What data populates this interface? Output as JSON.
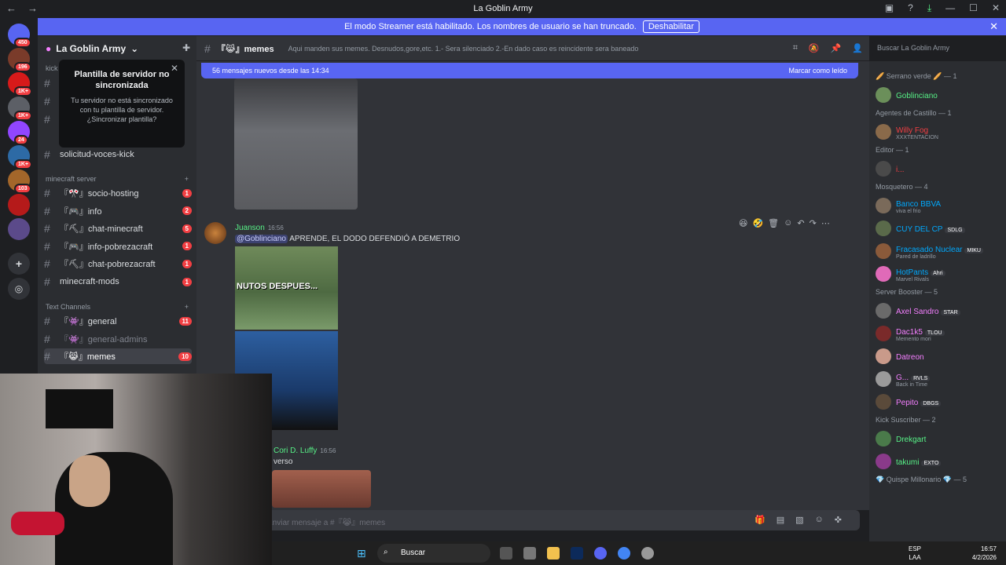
{
  "window": {
    "title": "La Goblin Army"
  },
  "banner": {
    "text": "El modo Streamer está habilitado. Los nombres de usuario se han truncado.",
    "button": "Deshabilitar"
  },
  "guilds": [
    {
      "badge": "450",
      "color": "#5865f2"
    },
    {
      "badge": "196",
      "color": "#7a3b2a"
    },
    {
      "badge": "1K+",
      "color": "#d71a1a"
    },
    {
      "badge": "1K+",
      "color": "#5c5f66"
    },
    {
      "badge": "24",
      "color": "#9146ff"
    },
    {
      "badge": "1K+",
      "color": "#2d6aa5"
    },
    {
      "badge": "103",
      "color": "#a3662a"
    },
    {
      "badge": "",
      "color": "#b51a1a"
    },
    {
      "badge": "",
      "color": "#5b4a8a"
    }
  ],
  "server": {
    "name": "La Goblin Army"
  },
  "popup": {
    "title": "Plantilla de servidor no sincronizada",
    "body": "Tu servidor no está sincronizado con tu plantilla de servidor. ¿Sincronizar plantilla?"
  },
  "channels": {
    "top_category": "kick",
    "solicitud": "solicitud-voces-kick",
    "minecraft_category": "minecraft server",
    "minecraft": [
      {
        "label": "『🎌』socio-hosting",
        "badge": "1"
      },
      {
        "label": "『🎮』info",
        "badge": "2"
      },
      {
        "label": "『⛏』chat-minecraft",
        "badge": "5"
      },
      {
        "label": "『🎮』info-pobrezacraft",
        "badge": "1"
      },
      {
        "label": "『⛏』chat-pobrezacraft",
        "badge": "1"
      },
      {
        "label": "minecraft-mods",
        "badge": "1"
      }
    ],
    "text_category": "Text Channels",
    "text": [
      {
        "label": "『👾』general",
        "badge": "11"
      },
      {
        "label": "『👾』general-admins",
        "badge": ""
      },
      {
        "label": "『😹』memes",
        "badge": "10"
      }
    ]
  },
  "channel_header": {
    "name": "『😹』memes",
    "topic": "Aqui manden sus memes. Desnudos,gore,etc. 1.- Sera silenciado 2.-En dado caso es reincidente sera baneado"
  },
  "search": {
    "placeholder": "Buscar La Goblin Army"
  },
  "new_messages": {
    "text": "56 mensajes nuevos desde las 14:34",
    "action": "Marcar como leído"
  },
  "messages": [
    {
      "author": "Juanson",
      "time": "16:56",
      "mention": "@Goblinciano",
      "text": "APRENDE, EL DODO DEFENDIÓ A DEMETRIO",
      "image_caption": "NUTOS DESPUES..."
    },
    {
      "author": "Cori D. Luffy",
      "time": "16:56",
      "text": "verso"
    }
  ],
  "composer": {
    "placeholder": "Enviar mensaje a #『😹』memes"
  },
  "members": [
    {
      "category": "🥖 Serrano verde 🥖 — 1"
    },
    {
      "name": "Goblinciano",
      "color": "#57f287",
      "av": "#6b8f5a"
    },
    {
      "category": "Agentes de Castillo — 1"
    },
    {
      "name": "Willy Fog",
      "color": "#f23f43",
      "sub": "XXXTENTACION",
      "av": "#8a6a4a"
    },
    {
      "category": "Editor — 1"
    },
    {
      "name": "i...",
      "color": "#f23f43",
      "av": "#4a4a4a"
    },
    {
      "category": "Mosquetero — 4"
    },
    {
      "name": "Banco BBVA",
      "color": "#00a8fc",
      "sub": "viva el frio",
      "av": "#7a6a5a"
    },
    {
      "name": "CUY DEL CP",
      "color": "#00a8fc",
      "tag": "SDLG",
      "av": "#5a6a4a"
    },
    {
      "name": "Fracasado Nuclear",
      "color": "#00a8fc",
      "tag": "MIKU",
      "sub": "Pared de ladrillo",
      "av": "#8a5a3a"
    },
    {
      "name": "HotPants",
      "color": "#00a8fc",
      "tag": "Ahri",
      "sub": "Marvel Rivals",
      "av": "#e06ab8"
    },
    {
      "category": "Server Booster — 5"
    },
    {
      "name": "Axel Sandro",
      "color": "#f47fff",
      "tag": "STAR",
      "av": "#6a6a6a"
    },
    {
      "name": "Dac1k5",
      "color": "#f47fff",
      "tag": "TLOU",
      "sub": "Memento mori",
      "av": "#7a2a2a"
    },
    {
      "name": "Datreon",
      "color": "#f47fff",
      "av": "#c99a8a"
    },
    {
      "name": "G...",
      "color": "#f47fff",
      "tag": "RVLS",
      "sub": "Back in Time",
      "av": "#9a9a9a"
    },
    {
      "name": "Pepito",
      "color": "#f47fff",
      "tag": "DBGS",
      "av": "#5a4a3a"
    },
    {
      "category": "Kick Suscriber — 2"
    },
    {
      "name": "Drekgart",
      "color": "#57f287",
      "av": "#4a7a4a"
    },
    {
      "name": "takumi",
      "color": "#57f287",
      "tag": "EXTO",
      "av": "#8a3a8a"
    },
    {
      "category": "💎 Quispe Millonario 💎 — 5"
    }
  ],
  "taskbar": {
    "search": "Buscar",
    "lang1": "ESP",
    "lang2": "LAA",
    "time": "16:57",
    "date": "4/2/2026"
  }
}
